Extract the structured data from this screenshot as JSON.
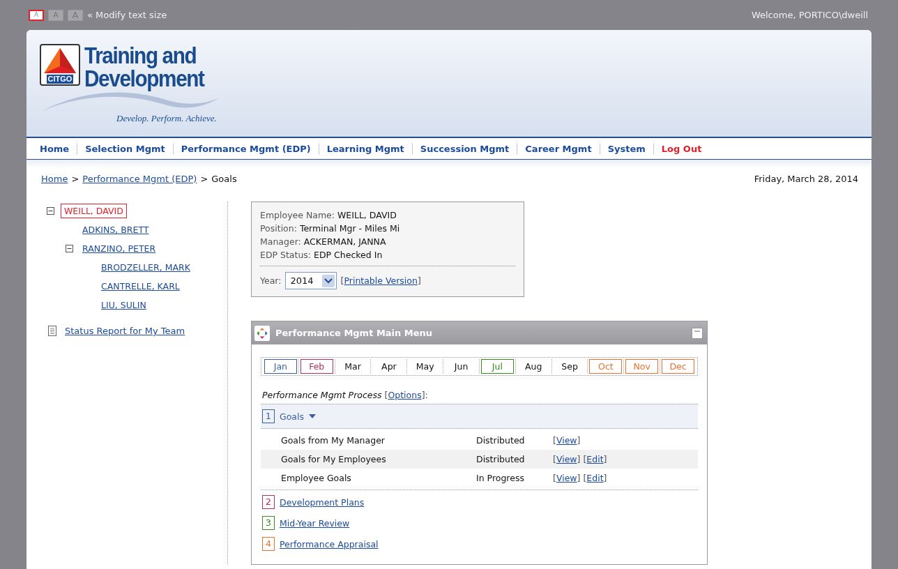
{
  "text_size": {
    "buttons": [
      {
        "label": "A",
        "selected": true
      },
      {
        "label": "A",
        "selected": false
      },
      {
        "label": "A",
        "selected": false
      }
    ],
    "label": "« Modify text size"
  },
  "welcome": "Welcome, PORTICO\\dweill",
  "header": {
    "logo_badge": "CITGO",
    "title_line_1": "Training and",
    "title_line_2": "Development",
    "tagline": "Develop. Perform. Achieve."
  },
  "nav": [
    {
      "label": "Home",
      "kind": "link"
    },
    {
      "label": "Selection Mgmt",
      "kind": "link"
    },
    {
      "label": "Performance Mgmt (EDP)",
      "kind": "link"
    },
    {
      "label": "Learning Mgmt",
      "kind": "link"
    },
    {
      "label": "Succession Mgmt",
      "kind": "link"
    },
    {
      "label": "Career Mgmt",
      "kind": "link"
    },
    {
      "label": "System",
      "kind": "link"
    },
    {
      "label": "Log Out",
      "kind": "logout"
    }
  ],
  "breadcrumb": {
    "links": [
      "Home",
      "Performance Mgmt (EDP)"
    ],
    "separator": ">",
    "current": "Goals"
  },
  "date": "Friday, March 28, 2014",
  "tree": [
    {
      "name": "WEILL, DAVID",
      "selected": true,
      "expanded": true,
      "children": [
        {
          "name": "ADKINS, BRETT",
          "selected": false
        },
        {
          "name": "RANZINO, PETER",
          "selected": false,
          "expanded": true,
          "children": [
            {
              "name": "BRODZELLER, MARK",
              "selected": false
            },
            {
              "name": "CANTRELLE, KARL",
              "selected": false
            },
            {
              "name": "LIU, SULIN",
              "selected": false
            }
          ]
        }
      ]
    }
  ],
  "status_report_link": "Status Report for My Team",
  "employee": {
    "fields": [
      {
        "label": "Employee Name:",
        "value": "WEILL, DAVID"
      },
      {
        "label": "Position:",
        "value": "Terminal Mgr - Miles Mi"
      },
      {
        "label": "Manager:",
        "value": "ACKERMAN, JANNA"
      },
      {
        "label": "EDP Status:",
        "value": "EDP Checked In"
      }
    ],
    "year_label": "Year:",
    "year": "2014",
    "printable_link": {
      "open": "[",
      "label": "Printable Version",
      "close": "]"
    }
  },
  "main_menu": {
    "title": "Performance Mgmt Main Menu",
    "months": [
      {
        "label": "Jan",
        "color": "#3a5fa0"
      },
      {
        "label": "Feb",
        "color": "#b03060"
      },
      {
        "label": "Mar"
      },
      {
        "label": "Apr"
      },
      {
        "label": "May"
      },
      {
        "label": "Jun"
      },
      {
        "label": "Jul",
        "color": "#3a8a20"
      },
      {
        "label": "Aug"
      },
      {
        "label": "Sep"
      },
      {
        "label": "Oct",
        "color": "#f07030"
      },
      {
        "label": "Nov",
        "color": "#f07030"
      },
      {
        "label": "Dec",
        "color": "#f07030"
      }
    ],
    "process_label": "Performance Mgmt Process",
    "options_link": {
      "open": "[",
      "label": "Options",
      "close": "]:"
    },
    "steps": [
      {
        "number": "1",
        "label": "Goals",
        "color": "#3a5fa0",
        "expanded": true,
        "items": [
          {
            "name": "Goals from My Manager",
            "status": "Distributed",
            "actions": [
              {
                "open": "[",
                "label": "View",
                "close": "]"
              }
            ]
          },
          {
            "name": "Goals for My Employees",
            "status": "Distributed",
            "actions": [
              {
                "open": "[",
                "label": "View",
                "close": "]"
              },
              {
                "open": "[",
                "label": "Edit",
                "close": "]"
              }
            ]
          },
          {
            "name": "Employee Goals",
            "status": "In Progress",
            "actions": [
              {
                "open": "[",
                "label": "View",
                "close": "]"
              },
              {
                "open": "[",
                "label": "Edit",
                "close": "]"
              }
            ]
          }
        ]
      },
      {
        "number": "2",
        "label": "Development Plans",
        "color": "#b03060",
        "expanded": false
      },
      {
        "number": "3",
        "label": "Mid-Year Review",
        "color": "#3a8a20",
        "expanded": false
      },
      {
        "number": "4",
        "label": "Performance Appraisal",
        "color": "#f07030",
        "expanded": false
      }
    ]
  }
}
